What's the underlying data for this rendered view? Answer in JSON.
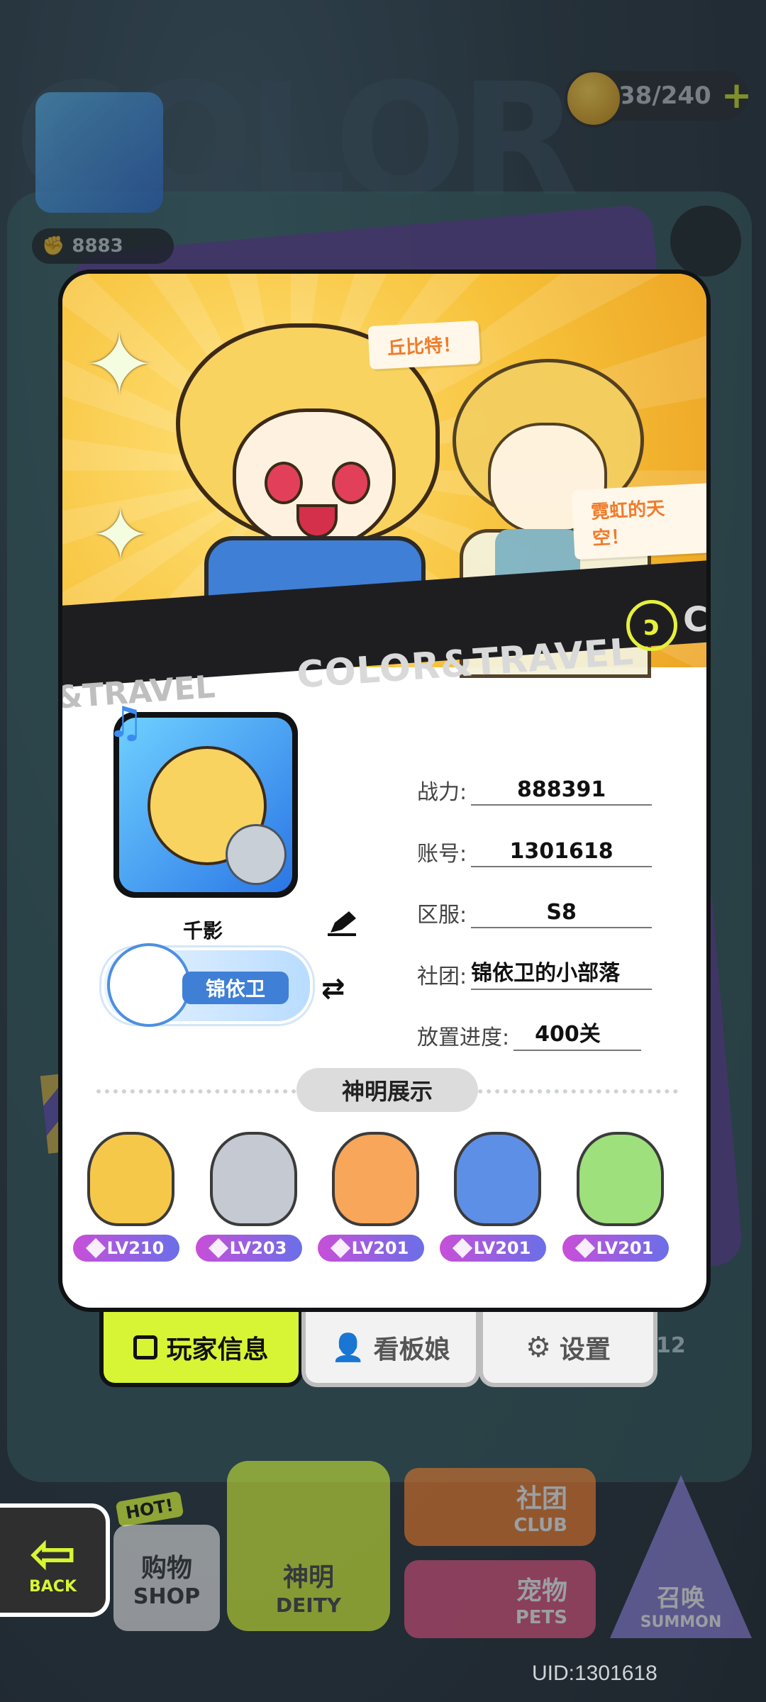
{
  "top": {
    "energy": "38/240",
    "power_short": "8883"
  },
  "banner": {
    "speech1": "丘比特！",
    "speech2": "霓虹的天空！",
    "strip_title": "COLOR&TRAVEL",
    "strip_title_left": "&TRAVEL",
    "strip_title_right": "CO"
  },
  "player": {
    "nickname": "千影",
    "club_badge": "锦依卫",
    "fields": [
      {
        "label": "战力:",
        "value": "888391"
      },
      {
        "label": "账号:",
        "value": "1301618"
      },
      {
        "label": "区服:",
        "value": "S8"
      },
      {
        "label": "社团:",
        "value": "锦依卫的小部落"
      },
      {
        "label": "放置进度:",
        "value": "400关"
      }
    ]
  },
  "deity_section": {
    "title": "神明展示",
    "deities": [
      {
        "level": "LV210",
        "color": "#f6c84a"
      },
      {
        "level": "LV203",
        "color": "#c4c9d2"
      },
      {
        "level": "LV201",
        "color": "#f7a65a"
      },
      {
        "level": "LV201",
        "color": "#5e8fe6"
      },
      {
        "level": "LV201",
        "color": "#9ee07c"
      }
    ]
  },
  "tabs": {
    "player_info": "玩家信息",
    "mascot": "看板娘",
    "settings": "设置"
  },
  "side_number": "12",
  "bottom_nav": {
    "back": "BACK",
    "hot": "HOT!",
    "shop_cn": "购物",
    "shop_en": "SHOP",
    "deity_cn": "神明",
    "deity_en": "DEITY",
    "club_cn": "社团",
    "club_en": "CLUB",
    "pets_cn": "宠物",
    "pets_en": "PETS",
    "summon_cn": "召唤",
    "summon_en": "SUMMON"
  },
  "uid": "UID:1301618"
}
